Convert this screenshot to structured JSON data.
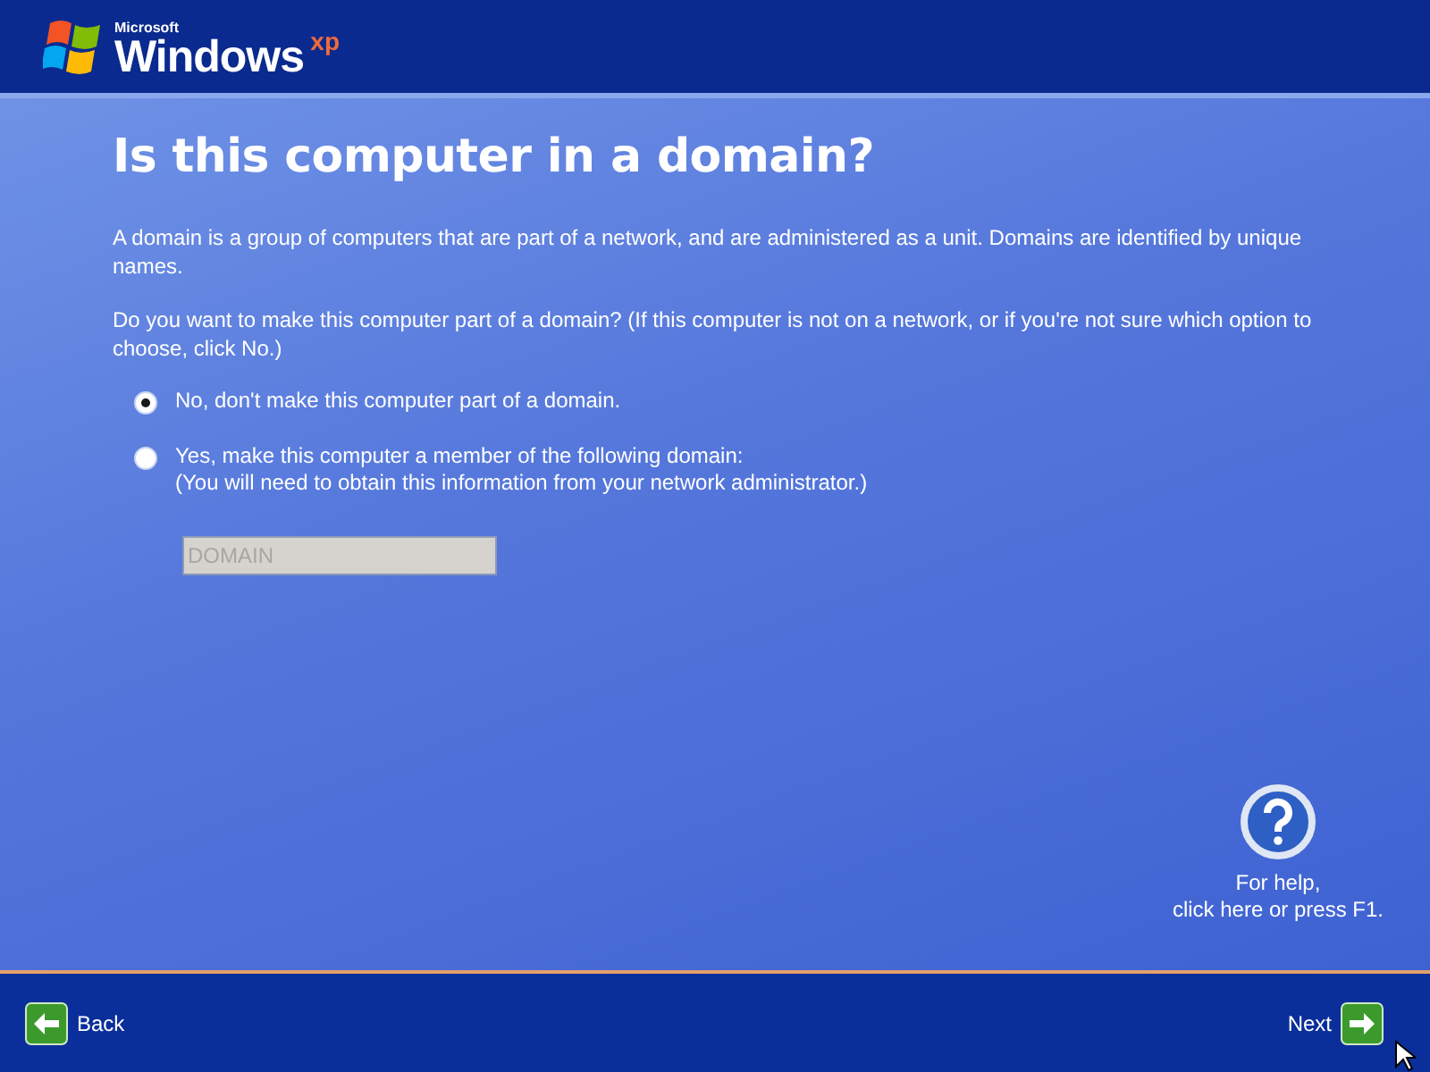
{
  "logo": {
    "maker": "Microsoft",
    "product": "Windows",
    "edition": "xp"
  },
  "title": "Is this computer in a domain?",
  "paragraphs": [
    "A domain is a group of computers that are part of a network, and are administered as a unit. Domains are identified by unique names.",
    "Do you want to make this computer part of a domain? (If this computer is not on a network, or if you're not sure which option to choose, click No.)"
  ],
  "options": [
    {
      "label": "No, don't make this computer part of a domain.",
      "selected": true
    },
    {
      "label": "Yes, make this computer a member of the following domain:",
      "note": "(You will need to obtain this information from your network administrator.)",
      "selected": false
    }
  ],
  "domain_field": {
    "value": "DOMAIN",
    "disabled": true
  },
  "help": {
    "line1": "For help,",
    "line2": "click here or press F1."
  },
  "buttons": {
    "back": "Back",
    "next": "Next"
  }
}
